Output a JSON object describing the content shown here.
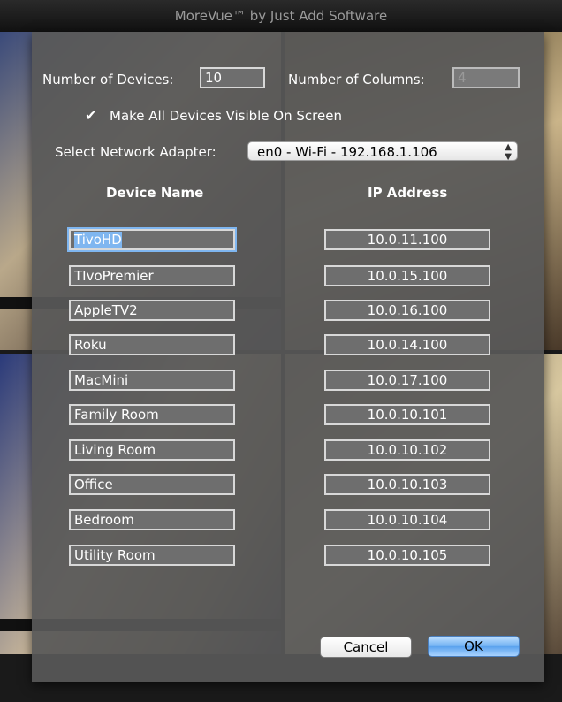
{
  "window": {
    "title": "MoreVue™ by Just Add Software"
  },
  "dialog": {
    "num_devices_label": "Number of Devices:",
    "num_devices_value": "10",
    "num_columns_label": "Number of Columns:",
    "num_columns_value": "4",
    "make_visible_label": "Make All Devices Visible On Screen",
    "make_visible_checked": true,
    "network_adapter_label": "Select Network Adapter:",
    "network_adapter_value": "en0 - Wi-Fi - 192.168.1.106",
    "col_device_name": "Device Name",
    "col_ip_address": "IP Address",
    "devices": [
      {
        "name": "TivoHD",
        "ip": "10.0.11.100"
      },
      {
        "name": "TIvoPremier",
        "ip": "10.0.15.100"
      },
      {
        "name": "AppleTV2",
        "ip": "10.0.16.100"
      },
      {
        "name": "Roku",
        "ip": "10.0.14.100"
      },
      {
        "name": "MacMini",
        "ip": "10.0.17.100"
      },
      {
        "name": "Family Room",
        "ip": "10.0.10.101"
      },
      {
        "name": "Living Room",
        "ip": "10.0.10.102"
      },
      {
        "name": "Office",
        "ip": "10.0.10.103"
      },
      {
        "name": "Bedroom",
        "ip": "10.0.10.104"
      },
      {
        "name": "Utility Room",
        "ip": "10.0.10.105"
      }
    ],
    "cancel_label": "Cancel",
    "ok_label": "OK"
  },
  "icons": {
    "checkmark": "checkmark-icon",
    "popup_arrows": "up-down-arrows-icon"
  },
  "colors": {
    "sheet_bg": "#585858",
    "focus_ring": "#7fb6f0",
    "default_button": "#5aa2ee"
  }
}
